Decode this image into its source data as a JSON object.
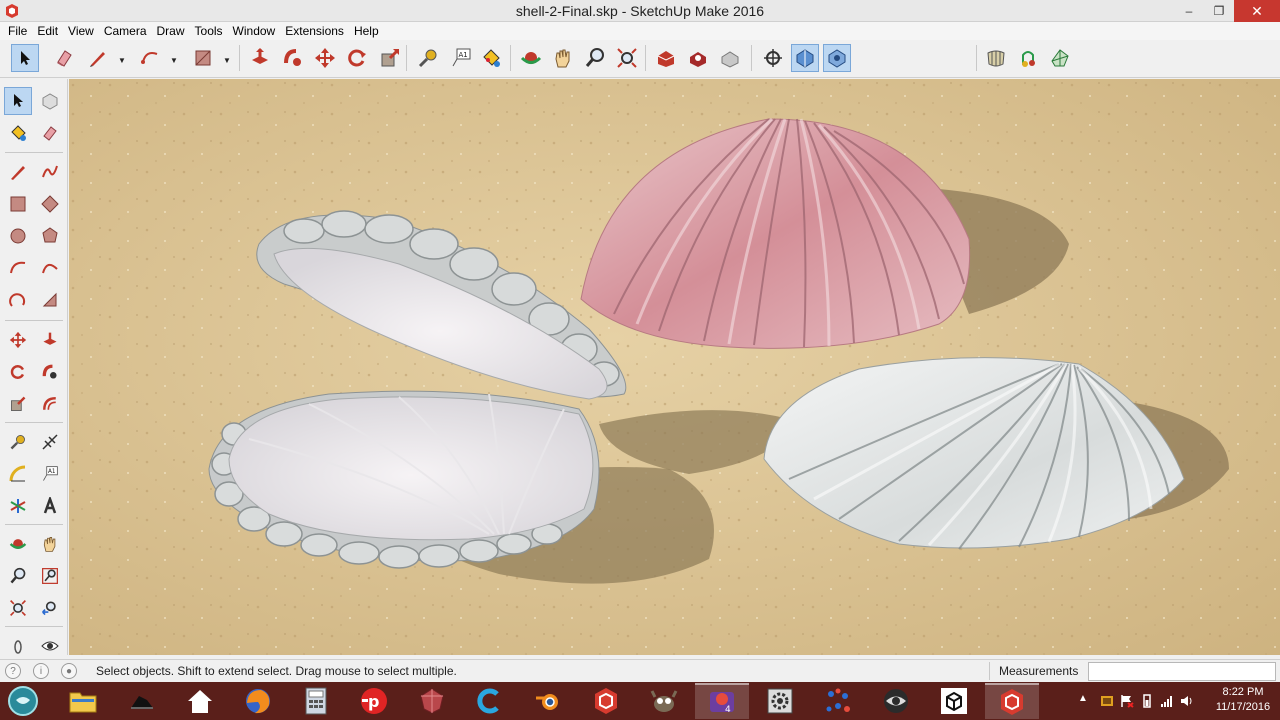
{
  "window": {
    "title": "shell-2-Final.skp - SketchUp Make 2016",
    "minimize": "–",
    "restore": "❐",
    "close": "✕"
  },
  "menu": [
    "File",
    "Edit",
    "View",
    "Camera",
    "Draw",
    "Tools",
    "Window",
    "Extensions",
    "Help"
  ],
  "toolbar": {
    "groups": [
      [
        "select-tool-icon",
        "eraser-tool-icon",
        "pencil-line-tool-icon",
        "arc-tool-icon",
        "rectangle-tool-icon"
      ],
      [
        "push-pull-tool-icon",
        "follow-me-tool-icon",
        "move-tool-icon",
        "rotate-tool-icon",
        "scale-tool-icon"
      ],
      [
        "tape-measure-tool-icon",
        "text-tool-icon",
        "paint-bucket-tool-icon"
      ],
      [
        "orbit-tool-icon",
        "pan-tool-icon",
        "zoom-tool-icon",
        "zoom-extents-tool-icon"
      ],
      [
        "warehouse-icon",
        "share-model-icon",
        "extension-warehouse-icon"
      ],
      [
        "position-camera-icon",
        "section-plane-icon",
        "display-section-icon"
      ],
      [
        "sandbox-icon",
        "location-icon",
        "photo-match-icon"
      ]
    ]
  },
  "sidebar": {
    "tools": [
      [
        "select-tool-icon",
        "component-tool-icon"
      ],
      [
        "paint-bucket-tool-icon",
        "eraser-tool-icon"
      ],
      [
        "line-tool-icon",
        "freehand-tool-icon"
      ],
      [
        "rectangle-tool-icon",
        "rotated-rectangle-tool-icon"
      ],
      [
        "circle-tool-icon",
        "polygon-tool-icon"
      ],
      [
        "arc-tool-icon",
        "two-point-arc-tool-icon"
      ],
      [
        "three-point-arc-tool-icon",
        "pie-tool-icon"
      ],
      [
        "move-tool-icon",
        "push-pull-tool-icon"
      ],
      [
        "rotate-tool-icon",
        "follow-me-tool-icon"
      ],
      [
        "scale-tool-icon",
        "offset-tool-icon"
      ],
      [
        "tape-measure-tool-icon",
        "dimension-tool-icon"
      ],
      [
        "protractor-tool-icon",
        "text-tool-icon"
      ],
      [
        "axes-tool-icon",
        "3d-text-tool-icon"
      ],
      [
        "orbit-tool-icon",
        "pan-tool-icon"
      ],
      [
        "zoom-tool-icon",
        "zoom-window-tool-icon"
      ],
      [
        "zoom-extents-tool-icon",
        "previous-view-icon"
      ],
      [
        "walk-tool-icon",
        "look-around-tool-icon"
      ]
    ]
  },
  "status": {
    "text": "Select objects. Shift to extend select. Drag mouse to select multiple.",
    "measurements_label": "Measurements",
    "measurements_value": ""
  },
  "taskbar": {
    "apps": [
      "start-orb-icon",
      "file-explorer-icon",
      "inkscape-icon",
      "home-icon",
      "firefox-icon",
      "calculator-icon",
      "pdf-app-icon",
      "gem-app-icon",
      "c-app-icon",
      "blender-icon",
      "sketchup-red-icon",
      "gimp-icon",
      "media-player-icon",
      "settings-app-icon",
      "network-graph-icon",
      "eye-app-icon",
      "cube-app-icon",
      "sketchup-active-icon"
    ],
    "time": "8:22 PM",
    "date": "11/17/2016"
  },
  "colors": {
    "sand": "#dcc495",
    "shell_white": "#e8e9e8",
    "shell_pink": "#d79aa0",
    "taskbar": "#5a1f1a",
    "close_button": "#c7372f",
    "active_tool": "#bcd7f2"
  }
}
